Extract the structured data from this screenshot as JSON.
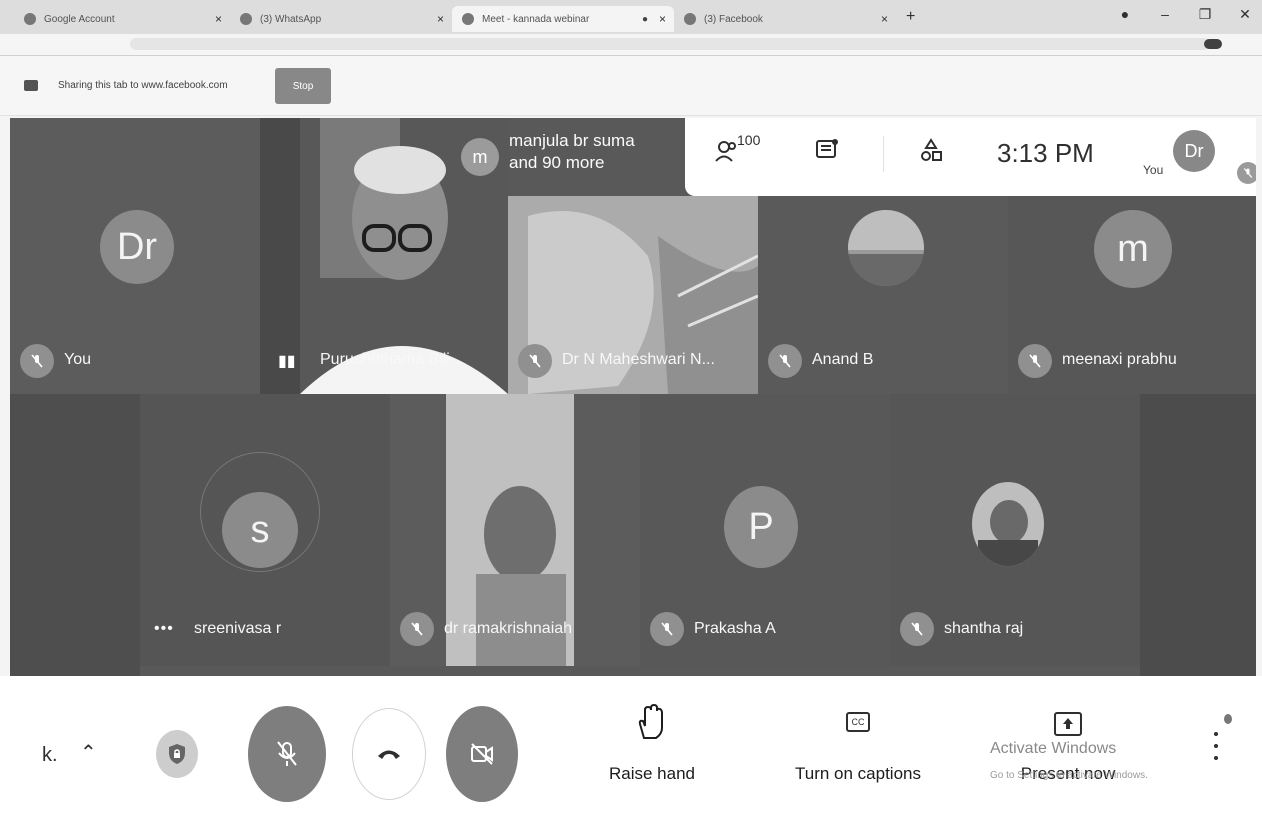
{
  "browser": {
    "tabs": [
      {
        "title": "Google Account",
        "active": false
      },
      {
        "title": "(3) WhatsApp",
        "active": false
      },
      {
        "title": "Meet - kannada webinar",
        "active": true
      },
      {
        "title": "(3) Facebook",
        "active": false
      }
    ],
    "new_tab": "+"
  },
  "share_bar": {
    "text": "Sharing this tab to www.facebook.com",
    "stop_label": "Stop"
  },
  "overlay": {
    "people_count": "100",
    "time": "3:13 PM",
    "you_label": "You",
    "you_initials": "Dr",
    "presenting_initial": "m",
    "presenting_text_line1": "manjula br suma",
    "presenting_text_line2": "and 90 more"
  },
  "participants_row1": [
    {
      "name": "You",
      "initial": "Dr",
      "muted": true
    },
    {
      "name": "Purushothama Bili...",
      "speaking": true
    },
    {
      "name": "Dr N Maheshwari N...",
      "muted": true
    },
    {
      "name": "Anand B",
      "muted": true
    },
    {
      "name": "meenaxi prabhu",
      "initial": "m",
      "muted": true
    }
  ],
  "participants_row2": [
    {
      "name": "sreenivasa r",
      "initial": "s"
    },
    {
      "name": "dr ramakrishnaiah",
      "muted": true
    },
    {
      "name": "Prakasha A",
      "initial": "P",
      "muted": true
    },
    {
      "name": "shantha raj",
      "muted": true
    }
  ],
  "controls": {
    "meeting_code": "k.",
    "caret": "^",
    "raise_hand": "Raise hand",
    "captions": "Turn on captions",
    "captions_icon": "CC",
    "present": "Present now",
    "watermark_line1": "Activate Windows",
    "watermark_line2": "Go to Settings to activate Windows."
  },
  "colors": {
    "tile": "#5b5b5b",
    "avatar": "#8a8a8a",
    "controls_bg": "#fbfbfb"
  }
}
